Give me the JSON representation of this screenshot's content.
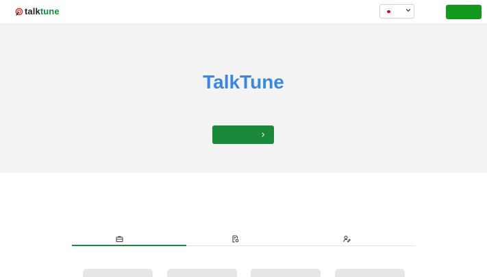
{
  "app": {
    "logo": {
      "text_talk": "talk",
      "text_tune": "tune",
      "icon": "broadcast-target-icon"
    }
  },
  "header": {
    "language": {
      "selected_flag": "japan-flag-icon",
      "chevron": "chevron-down-icon"
    },
    "action_button": {
      "label": ""
    }
  },
  "hero": {
    "title": "TalkTune",
    "cta": {
      "label": "",
      "icon": "chevron-right-icon"
    }
  },
  "tabs": [
    {
      "icon": "briefcase-icon",
      "active": true
    },
    {
      "icon": "document-settings-icon",
      "active": false
    },
    {
      "icon": "user-edit-icon",
      "active": false
    }
  ],
  "cards": [
    {
      "label": ""
    },
    {
      "label": ""
    },
    {
      "label": ""
    },
    {
      "label": ""
    }
  ],
  "colors": {
    "brand_green": "#1a8a3a",
    "button_green": "#13991f",
    "title_blue": "#3b87e0",
    "hero_bg": "#f3f3f3"
  }
}
